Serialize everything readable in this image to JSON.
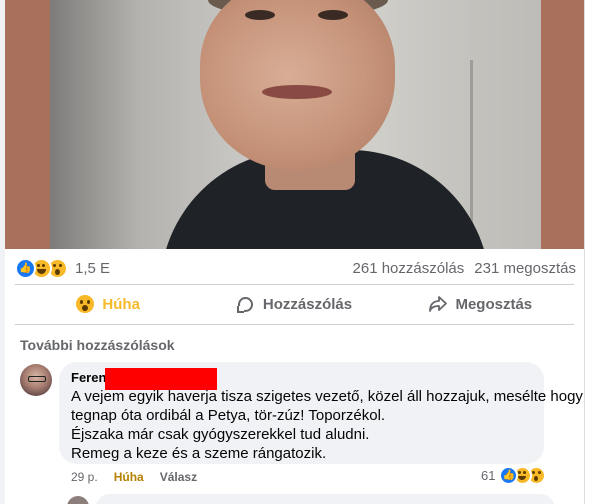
{
  "post": {
    "reaction_count": "1,5 E",
    "comments_count": "261 hozzászólás",
    "shares_count": "231 megosztás",
    "reaction_icons": [
      "like-icon",
      "haha-icon",
      "wow-icon"
    ]
  },
  "actions": {
    "react_label": "Húha",
    "comment_label": "Hozzászólás",
    "share_label": "Megosztás"
  },
  "comments_section": {
    "more_label": "További hozzászólások"
  },
  "comment": {
    "author": "Ferenc",
    "lines": [
      "A vejem egyik haverja tisza szigetes vezető, közel áll hozzajuk, mesélte hogy",
      "tegnap óta ordibál a Petya, tör-zúz! Toporzékol.",
      "Éjszaka már csak gyógyszerekkel tud aludni.",
      "Remeg a keze és a szeme rángatozik."
    ],
    "time": "29 p.",
    "reaction_link": "Húha",
    "reply_label": "Válasz",
    "reaction_count": "61"
  },
  "colors": {
    "accent": "#1877f2",
    "wow": "#f7b928",
    "redaction": "#ff0000"
  }
}
